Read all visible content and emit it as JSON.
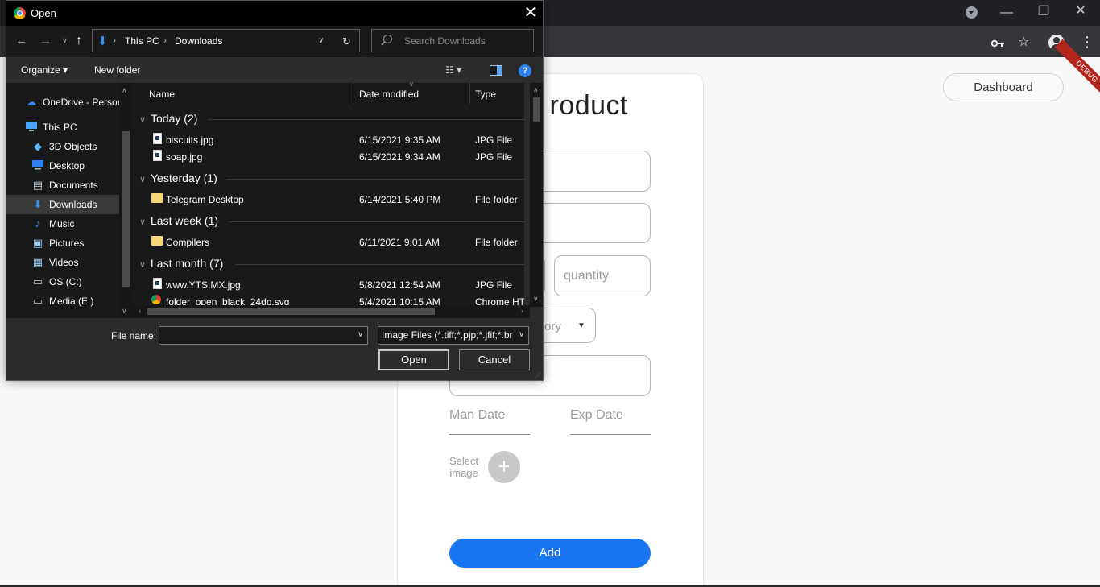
{
  "browser": {
    "minimize_icon": "—",
    "restore_icon": "❐",
    "close_icon": "✕",
    "key_icon": "key-icon",
    "star_icon": "☆",
    "menu_icon": "⋮"
  },
  "page": {
    "title": "roduct",
    "fields": {
      "quantity_placeholder": "quantity",
      "category_placeholder": "ory",
      "man_date_placeholder": "Man Date",
      "exp_date_placeholder": "Exp Date"
    },
    "select_image_label": "Select\nimage",
    "add_button": "Add",
    "dashboard_button": "Dashboard",
    "debug_banner": "DEBUG"
  },
  "dialog": {
    "title": "Open",
    "address": {
      "segments": [
        "This PC",
        "Downloads"
      ],
      "separator": "›"
    },
    "search_placeholder": "Search Downloads",
    "toolbar": {
      "organize": "Organize ▾",
      "new_folder": "New folder",
      "help": "?"
    },
    "nav_items": [
      {
        "label": "OneDrive - Persor",
        "icon": "☁",
        "color": "#3b8ee8"
      },
      {
        "label": "This PC",
        "icon": "🖥",
        "color": "#4aa3ff"
      },
      {
        "label": "3D Objects",
        "icon": "◆",
        "color": "#5ab8f0"
      },
      {
        "label": "Desktop",
        "icon": "▬",
        "color": "#2f80ed"
      },
      {
        "label": "Documents",
        "icon": "▤",
        "color": "#c8d4e0"
      },
      {
        "label": "Downloads",
        "icon": "⬇",
        "color": "#3b8ee8"
      },
      {
        "label": "Music",
        "icon": "♪",
        "color": "#3b8ee8"
      },
      {
        "label": "Pictures",
        "icon": "▣",
        "color": "#9bd0f5"
      },
      {
        "label": "Videos",
        "icon": "▦",
        "color": "#9bd0f5"
      },
      {
        "label": "OS (C:)",
        "icon": "▭",
        "color": "#c8c8c8"
      },
      {
        "label": "Media (E:)",
        "icon": "▭",
        "color": "#c8c8c8"
      }
    ],
    "columns": {
      "name": "Name",
      "date": "Date modified",
      "type": "Type"
    },
    "groups": [
      {
        "label": "Today (2)"
      },
      {
        "label": "Yesterday (1)"
      },
      {
        "label": "Last week (1)"
      },
      {
        "label": "Last month (7)"
      }
    ],
    "files": [
      {
        "name": "biscuits.jpg",
        "date": "6/15/2021 9:35 AM",
        "type": "JPG File"
      },
      {
        "name": "soap.jpg",
        "date": "6/15/2021 9:34 AM",
        "type": "JPG File"
      },
      {
        "name": "Telegram Desktop",
        "date": "6/14/2021 5:40 PM",
        "type": "File folder"
      },
      {
        "name": "Compilers",
        "date": "6/11/2021 9:01 AM",
        "type": "File folder"
      },
      {
        "name": "www.YTS.MX.jpg",
        "date": "5/8/2021 12:54 AM",
        "type": "JPG File"
      },
      {
        "name": "folder_open_black_24dp.svg",
        "date": "5/4/2021 10:15 AM",
        "type": "Chrome HTM"
      }
    ],
    "file_name_label": "File name:",
    "file_name_value": "",
    "filter_value": "Image Files (*.tiff;*.pjp;*.jfif;*.br",
    "open_button": "Open",
    "cancel_button": "Cancel"
  }
}
